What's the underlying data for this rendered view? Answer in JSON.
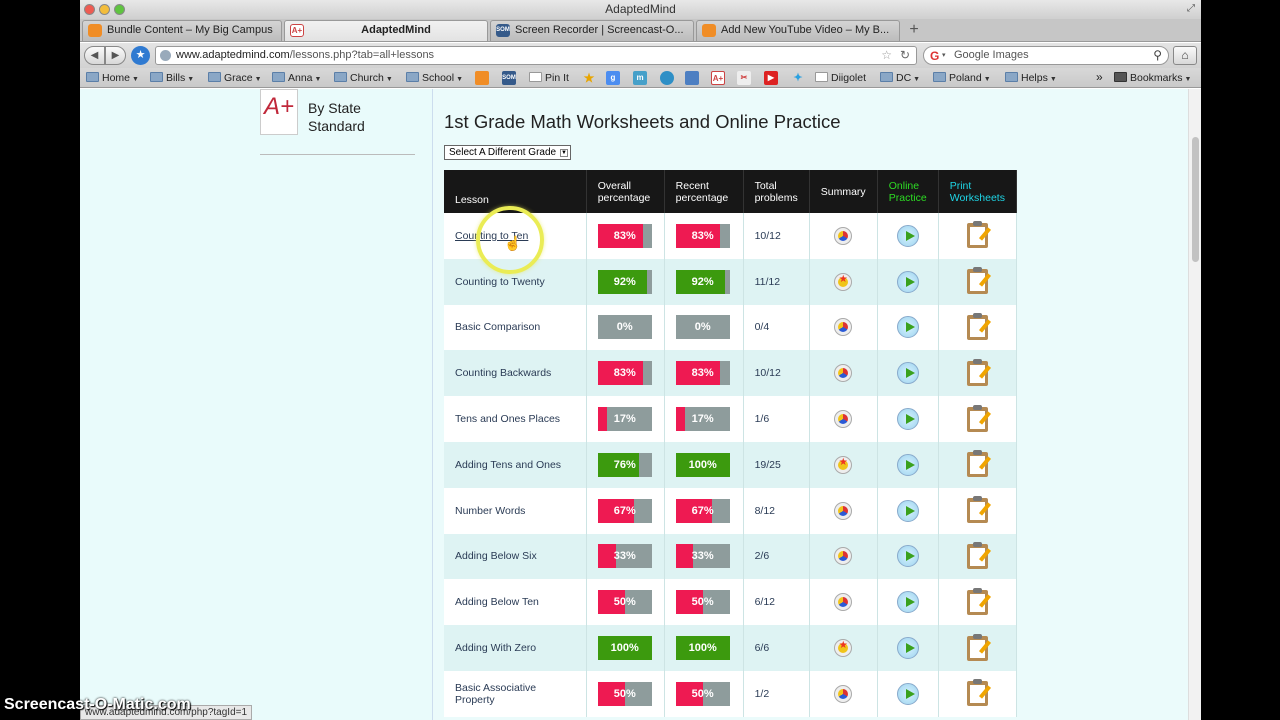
{
  "window": {
    "title": "AdaptedMind"
  },
  "tabs": [
    {
      "label": "Bundle Content – My Big Campus",
      "favicon": "orange-chat-icon",
      "active": false
    },
    {
      "label": "AdaptedMind",
      "favicon": "aplus-icon",
      "active": true
    },
    {
      "label": "Screen Recorder | Screencast-O...",
      "favicon": "som-icon",
      "active": false
    },
    {
      "label": "Add New YouTube Video – My B...",
      "favicon": "orange-chat-icon",
      "active": false
    }
  ],
  "nav": {
    "url_domain": "www.adaptedmind.com",
    "url_path": "/lessons.php?tab=all+lessons",
    "search_placeholder": "Google Images",
    "google_letter": "G"
  },
  "bookmarks": {
    "folders": [
      "Home",
      "Bills",
      "Grace",
      "Anna",
      "Church",
      "School"
    ],
    "pin_it": "Pin It",
    "diigolet": "Diigolet",
    "folders2": [
      "DC",
      "Poland",
      "Helps"
    ],
    "more": "»",
    "bookmarks_label": "Bookmarks"
  },
  "sidebar": {
    "aplus": "A+",
    "standard_label": "By State Standard"
  },
  "main": {
    "title": "1st Grade Math Worksheets and Online Practice",
    "grade_select": "Select A Different Grade"
  },
  "table": {
    "headers": {
      "lesson": "Lesson",
      "overall": "Overall percentage",
      "recent": "Recent percentage",
      "total": "Total problems",
      "summary": "Summary",
      "online": "Online Practice",
      "print": "Print Worksheets"
    },
    "rows": [
      {
        "lesson": "Counting to Ten",
        "overall": 83,
        "overall_label": "83%",
        "overall_color": "red",
        "recent": 83,
        "recent_label": "83%",
        "recent_color": "red",
        "problems": "10/12",
        "summary": "chart"
      },
      {
        "lesson": "Counting to Twenty",
        "overall": 92,
        "overall_label": "92%",
        "overall_color": "green",
        "recent": 92,
        "recent_label": "92%",
        "recent_color": "green",
        "problems": "11/12",
        "summary": "star"
      },
      {
        "lesson": "Basic Comparison",
        "overall": 0,
        "overall_label": "0%",
        "overall_color": "red",
        "recent": 0,
        "recent_label": "0%",
        "recent_color": "red",
        "problems": "0/4",
        "summary": "chart"
      },
      {
        "lesson": "Counting Backwards",
        "overall": 83,
        "overall_label": "83%",
        "overall_color": "red",
        "recent": 83,
        "recent_label": "83%",
        "recent_color": "red",
        "problems": "10/12",
        "summary": "chart"
      },
      {
        "lesson": "Tens and Ones Places",
        "overall": 17,
        "overall_label": "17%",
        "overall_color": "red",
        "recent": 17,
        "recent_label": "17%",
        "recent_color": "red",
        "problems": "1/6",
        "summary": "chart"
      },
      {
        "lesson": "Adding Tens and Ones",
        "overall": 76,
        "overall_label": "76%",
        "overall_color": "green",
        "recent": 100,
        "recent_label": "100%",
        "recent_color": "green",
        "problems": "19/25",
        "summary": "star"
      },
      {
        "lesson": "Number Words",
        "overall": 67,
        "overall_label": "67%",
        "overall_color": "red",
        "recent": 67,
        "recent_label": "67%",
        "recent_color": "red",
        "problems": "8/12",
        "summary": "chart"
      },
      {
        "lesson": "Adding Below Six",
        "overall": 33,
        "overall_label": "33%",
        "overall_color": "red",
        "recent": 33,
        "recent_label": "33%",
        "recent_color": "red",
        "problems": "2/6",
        "summary": "chart"
      },
      {
        "lesson": "Adding Below Ten",
        "overall": 50,
        "overall_label": "50%",
        "overall_color": "red",
        "recent": 50,
        "recent_label": "50%",
        "recent_color": "red",
        "problems": "6/12",
        "summary": "chart"
      },
      {
        "lesson": "Adding With Zero",
        "overall": 100,
        "overall_label": "100%",
        "overall_color": "green",
        "recent": 100,
        "recent_label": "100%",
        "recent_color": "green",
        "problems": "6/6",
        "summary": "star"
      },
      {
        "lesson": "Basic Associative Property",
        "overall": 50,
        "overall_label": "50%",
        "overall_color": "red",
        "recent": 50,
        "recent_label": "50%",
        "recent_color": "red",
        "problems": "1/2",
        "summary": "chart"
      }
    ]
  },
  "status_bar": {
    "url": "www.adaptedmind.com/php?tagId=1"
  },
  "watermark": "Screencast-O-Matic.com",
  "colors": {
    "red_bar": "#ee1a52",
    "green_bar": "#3c9a0e",
    "gray_bar": "#8e9c9c",
    "online_header": "#2ddc24",
    "print_header": "#1fd6e6",
    "page_bg": "#e9fbfb"
  }
}
